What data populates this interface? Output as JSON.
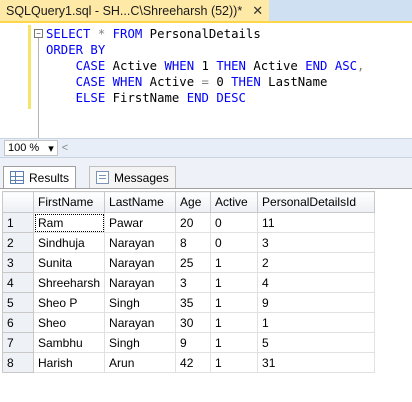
{
  "tab": {
    "title": "SQLQuery1.sql - SH...C\\Shreeharsh (52))*",
    "close_glyph": "✕"
  },
  "editor": {
    "lines": [
      {
        "parts": [
          {
            "t": "SELECT",
            "c": "kw"
          },
          {
            "t": " ",
            "c": ""
          },
          {
            "t": "*",
            "c": "gray"
          },
          {
            "t": " ",
            "c": ""
          },
          {
            "t": "FROM",
            "c": "kw"
          },
          {
            "t": " PersonalDetails",
            "c": ""
          }
        ]
      },
      {
        "parts": [
          {
            "t": "ORDER BY",
            "c": "kw"
          }
        ]
      },
      {
        "parts": [
          {
            "t": "    ",
            "c": ""
          },
          {
            "t": "CASE",
            "c": "kw"
          },
          {
            "t": " Active ",
            "c": ""
          },
          {
            "t": "WHEN",
            "c": "kw"
          },
          {
            "t": " 1 ",
            "c": ""
          },
          {
            "t": "THEN",
            "c": "kw"
          },
          {
            "t": " Active ",
            "c": ""
          },
          {
            "t": "END",
            "c": "kw"
          },
          {
            "t": " ",
            "c": ""
          },
          {
            "t": "ASC",
            "c": "kw"
          },
          {
            "t": ",",
            "c": "gray"
          }
        ]
      },
      {
        "parts": [
          {
            "t": "    ",
            "c": ""
          },
          {
            "t": "CASE",
            "c": "kw"
          },
          {
            "t": " ",
            "c": ""
          },
          {
            "t": "WHEN",
            "c": "kw"
          },
          {
            "t": " Active ",
            "c": ""
          },
          {
            "t": "=",
            "c": "gray"
          },
          {
            "t": " 0 ",
            "c": ""
          },
          {
            "t": "THEN",
            "c": "kw"
          },
          {
            "t": " LastName",
            "c": ""
          }
        ]
      },
      {
        "parts": [
          {
            "t": "    ",
            "c": ""
          },
          {
            "t": "ELSE",
            "c": "kw"
          },
          {
            "t": " FirstName ",
            "c": ""
          },
          {
            "t": "END",
            "c": "kw"
          },
          {
            "t": " ",
            "c": ""
          },
          {
            "t": "DESC",
            "c": "kw"
          }
        ]
      }
    ],
    "collapse_glyph": "−"
  },
  "status": {
    "zoom": "100 %",
    "zoom_arrow": "▾",
    "scroll_left": "<"
  },
  "results_tabs": {
    "results": "Results",
    "messages": "Messages"
  },
  "grid": {
    "columns": [
      "FirstName",
      "LastName",
      "Age",
      "Active",
      "PersonalDetailsId"
    ],
    "rows": [
      [
        "1",
        "Ram",
        "Pawar",
        "20",
        "0",
        "11"
      ],
      [
        "2",
        "Sindhuja",
        "Narayan",
        "8",
        "0",
        "3"
      ],
      [
        "3",
        "Sunita",
        "Narayan",
        "25",
        "1",
        "2"
      ],
      [
        "4",
        "Shreeharsh",
        "Narayan",
        "3",
        "1",
        "4"
      ],
      [
        "5",
        "Sheo P",
        "Singh",
        "35",
        "1",
        "9"
      ],
      [
        "6",
        "Sheo",
        "Narayan",
        "30",
        "1",
        "1"
      ],
      [
        "7",
        "Sambhu",
        "Singh",
        "9",
        "1",
        "5"
      ],
      [
        "8",
        "Harish",
        "Arun",
        "42",
        "1",
        "31"
      ]
    ]
  },
  "colors": {
    "keyword": "#0000ff",
    "operator": "#808080",
    "tab_active": "#ffe9a6",
    "tab_strip": "#cfe0f2"
  }
}
